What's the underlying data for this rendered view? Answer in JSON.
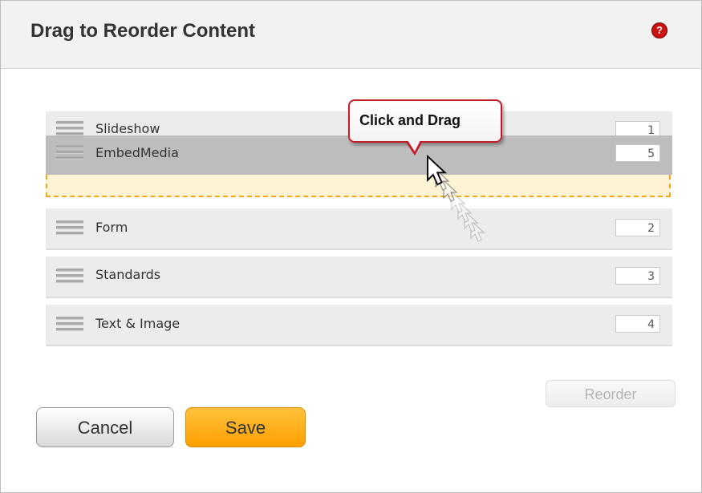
{
  "dialog": {
    "title": "Drag to Reorder Content",
    "help_icon": "question-icon"
  },
  "items": [
    {
      "label": "Slideshow",
      "order": "1"
    },
    {
      "label": "EmbedMedia",
      "order": "5"
    },
    {
      "label": "Form",
      "order": "2"
    },
    {
      "label": "Standards",
      "order": "3"
    },
    {
      "label": "Text & Image",
      "order": "4"
    }
  ],
  "callout": {
    "text": "Click and Drag"
  },
  "buttons": {
    "reorder": "Reorder",
    "cancel": "Cancel",
    "save": "Save"
  },
  "colors": {
    "accent": "#ff9f00",
    "callout_border": "#c21d2a",
    "drop_placeholder_border": "#f2a91c"
  }
}
